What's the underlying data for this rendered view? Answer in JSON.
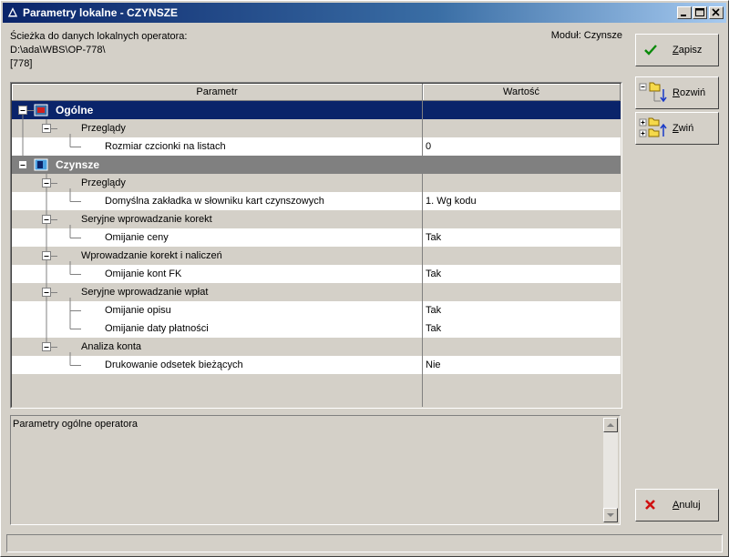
{
  "window": {
    "title": "Parametry lokalne - CZYNSZE",
    "controls": [
      "minimize-icon",
      "maximize-icon",
      "close-icon"
    ]
  },
  "info": {
    "path_label": "Ścieżka do danych lokalnych operatora:",
    "path_value": "D:\\ada\\WBS\\OP-778\\",
    "operator_id": "[778]",
    "module": "Moduł: Czynsze"
  },
  "grid": {
    "columns": [
      "Parametr",
      "Wartość"
    ],
    "rows": [
      {
        "type": "category",
        "selected": true,
        "icon": "ogolne-icon",
        "label": "Ogólne",
        "value": ""
      },
      {
        "type": "group",
        "label": "Przeglądy",
        "value": ""
      },
      {
        "type": "leaf",
        "label": "Rozmiar czcionki na listach",
        "value": "0"
      },
      {
        "type": "category",
        "selected": false,
        "icon": "czynsze-icon",
        "label": "Czynsze",
        "value": ""
      },
      {
        "type": "group",
        "label": "Przeglądy",
        "value": ""
      },
      {
        "type": "leaf",
        "label": "Domyślna zakładka w słowniku kart czynszowych",
        "value": "1. Wg kodu"
      },
      {
        "type": "group",
        "label": "Seryjne wprowadzanie korekt",
        "value": ""
      },
      {
        "type": "leaf",
        "label": "Omijanie ceny",
        "value": "Tak"
      },
      {
        "type": "group",
        "label": "Wprowadzanie korekt i naliczeń",
        "value": ""
      },
      {
        "type": "leaf",
        "label": "Omijanie kont FK",
        "value": "Tak"
      },
      {
        "type": "group",
        "label": "Seryjne wprowadzanie wpłat",
        "value": ""
      },
      {
        "type": "leaf",
        "label": "Omijanie opisu",
        "value": "Tak"
      },
      {
        "type": "leaf",
        "label": "Omijanie daty płatności",
        "value": "Tak"
      },
      {
        "type": "group",
        "label": "Analiza konta",
        "value": ""
      },
      {
        "type": "leaf",
        "label": "Drukowanie odsetek bieżących",
        "value": "Nie"
      }
    ]
  },
  "description": {
    "text": "Parametry ogólne operatora"
  },
  "buttons": {
    "save": "Zapisz",
    "expand": "Rozwiń",
    "collapse": "Zwiń",
    "cancel": "Anuluj"
  },
  "colors": {
    "selection": "#0a246a",
    "category": "#808080",
    "face": "#d4d0c8"
  }
}
